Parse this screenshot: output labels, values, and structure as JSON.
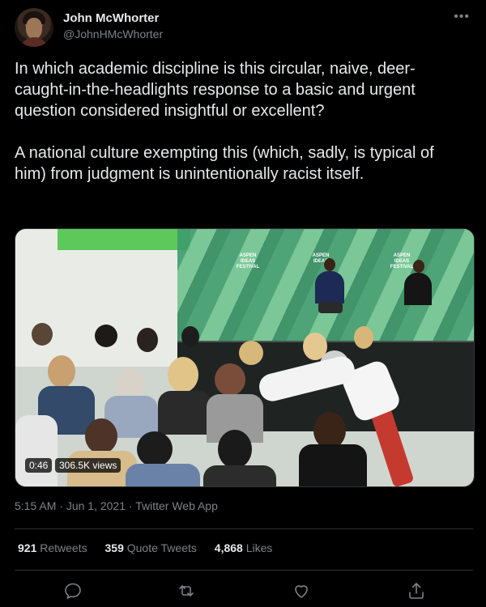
{
  "author": {
    "name": "John McWhorter",
    "handle": "@JohnHMcWhorter"
  },
  "more_icon": "•••",
  "tweet": {
    "paragraph1": "In which academic discipline is this circular, naive, deer-caught-in-the-headlights response to a basic and urgent question considered insightful or excellent?",
    "paragraph2": "A national culture exempting this (which, sadly, is typical of him) from judgment is unintentionally racist itself."
  },
  "video": {
    "duration": "0:46",
    "views": "306.5K views",
    "banner_text": "ASPEN IDEAS FESTIVAL",
    "banner_short": "ASPEN IDEAS"
  },
  "meta": {
    "time": "5:15 AM",
    "sep": "·",
    "date": "Jun 1, 2021",
    "source": "Twitter Web App"
  },
  "stats": {
    "retweets_count": "921",
    "retweets_label": "Retweets",
    "quotes_count": "359",
    "quotes_label": "Quote Tweets",
    "likes_count": "4,868",
    "likes_label": "Likes"
  },
  "colors": {
    "background": "#000000",
    "text_primary": "#e7e9ea",
    "text_secondary": "#7d8288",
    "divider": "#2f3336"
  },
  "action_icons": [
    "reply-icon",
    "retweet-icon",
    "like-icon",
    "share-icon"
  ]
}
